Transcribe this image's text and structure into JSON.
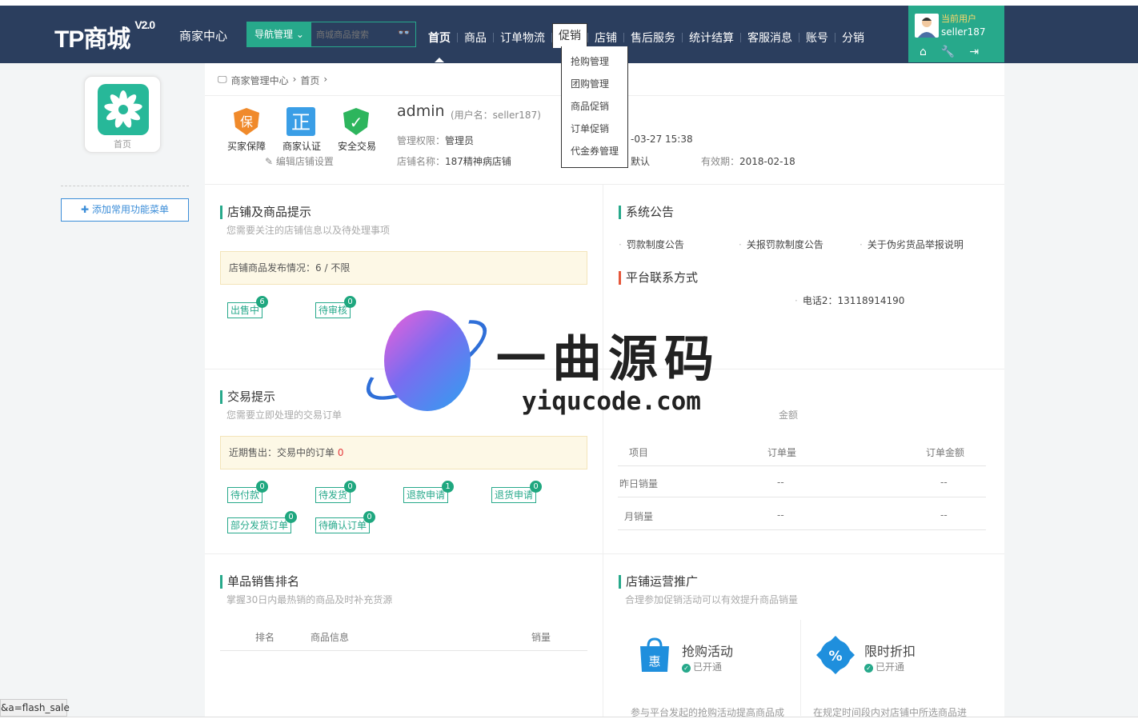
{
  "header": {
    "logo": "TP商城",
    "version": "V2.0",
    "merchant_center": "商家中心",
    "nav_manage": "导航管理",
    "search_placeholder": "商城商品搜索",
    "nav": [
      {
        "label": "首页"
      },
      {
        "label": "商品"
      },
      {
        "label": "订单物流"
      },
      {
        "label": "促销"
      },
      {
        "label": "店铺"
      },
      {
        "label": "售后服务"
      },
      {
        "label": "统计结算"
      },
      {
        "label": "客服消息"
      },
      {
        "label": "账号"
      },
      {
        "label": "分销"
      }
    ],
    "promo_dropdown": [
      "抢购管理",
      "团购管理",
      "商品促销",
      "订单促销",
      "代金券管理"
    ],
    "current_user_label": "当前用户",
    "username": "seller187"
  },
  "sidebar": {
    "home_label": "首页",
    "add_menu": "添加常用功能菜单"
  },
  "breadcrumb": [
    "商家管理中心",
    "›",
    "首页",
    "›"
  ],
  "badges": [
    "买家保障",
    "商家认证",
    "安全交易"
  ],
  "badge_glyphs": [
    "保",
    "正",
    "✓"
  ],
  "edit_store": "编辑店铺设置",
  "account": {
    "name": "admin",
    "user_sub": "(用户名：seller187)",
    "perm_label": "管理权限：",
    "perm_value": "管理员",
    "last_login": "-03-27 15:38",
    "store_label": "店铺名称：",
    "store_value": "187精神病店铺",
    "level_value": "默认",
    "valid_label": "有效期：",
    "valid_value": "2018-02-18"
  },
  "store_tips": {
    "title": "店铺及商品提示",
    "sub": "您需要关注的店铺信息以及待处理事项",
    "notice_prefix": "店铺商品发布情况：6 / ",
    "notice_value": "不限",
    "tags": [
      {
        "label": "出售中",
        "count": "6"
      },
      {
        "label": "待审核",
        "count": "0"
      }
    ]
  },
  "announcements": {
    "title": "系统公告",
    "items": [
      "罚款制度公告",
      "关报罚款制度公告",
      "关于伪劣货品举报说明"
    ]
  },
  "contact": {
    "title": "平台联系方式",
    "phone2": "电话2：13118914190"
  },
  "trade_tips": {
    "title": "交易提示",
    "sub": "您需要立即处理的交易订单",
    "notice_prefix": "近期售出：交易中的订单 ",
    "notice_count": "0",
    "tags": [
      {
        "label": "待付款",
        "count": "0"
      },
      {
        "label": "待发货",
        "count": "0"
      },
      {
        "label": "退款申请",
        "count": "1"
      },
      {
        "label": "退货申请",
        "count": "0"
      },
      {
        "label": "部分发货订单",
        "count": "0"
      },
      {
        "label": "待确认订单",
        "count": "0"
      }
    ]
  },
  "sales_stats": {
    "amount_label": "金额",
    "headers": [
      "项目",
      "订单量",
      "订单金额"
    ],
    "rows": [
      {
        "item": "昨日销量",
        "orders": "--",
        "amount": "--"
      },
      {
        "item": "月销量",
        "orders": "--",
        "amount": "--"
      }
    ]
  },
  "ranking": {
    "title": "单品销售排名",
    "sub": "掌握30日内最热销的商品及时补充货源",
    "headers": [
      "排名",
      "商品信息",
      "销量"
    ]
  },
  "promotion": {
    "title": "店铺运营推广",
    "sub": "合理参加促销活动可以有效提升商品销量",
    "items": [
      {
        "name": "抢购活动",
        "status": "已开通",
        "desc": "参与平台发起的抢购活动提高商品成"
      },
      {
        "name": "限时折扣",
        "status": "已开通",
        "desc": "在规定时间段内对店铺中所选商品进"
      }
    ]
  },
  "watermark": {
    "text": "一曲源码",
    "url": "yiqucode.com"
  },
  "statusbar": "&a=flash_sale"
}
